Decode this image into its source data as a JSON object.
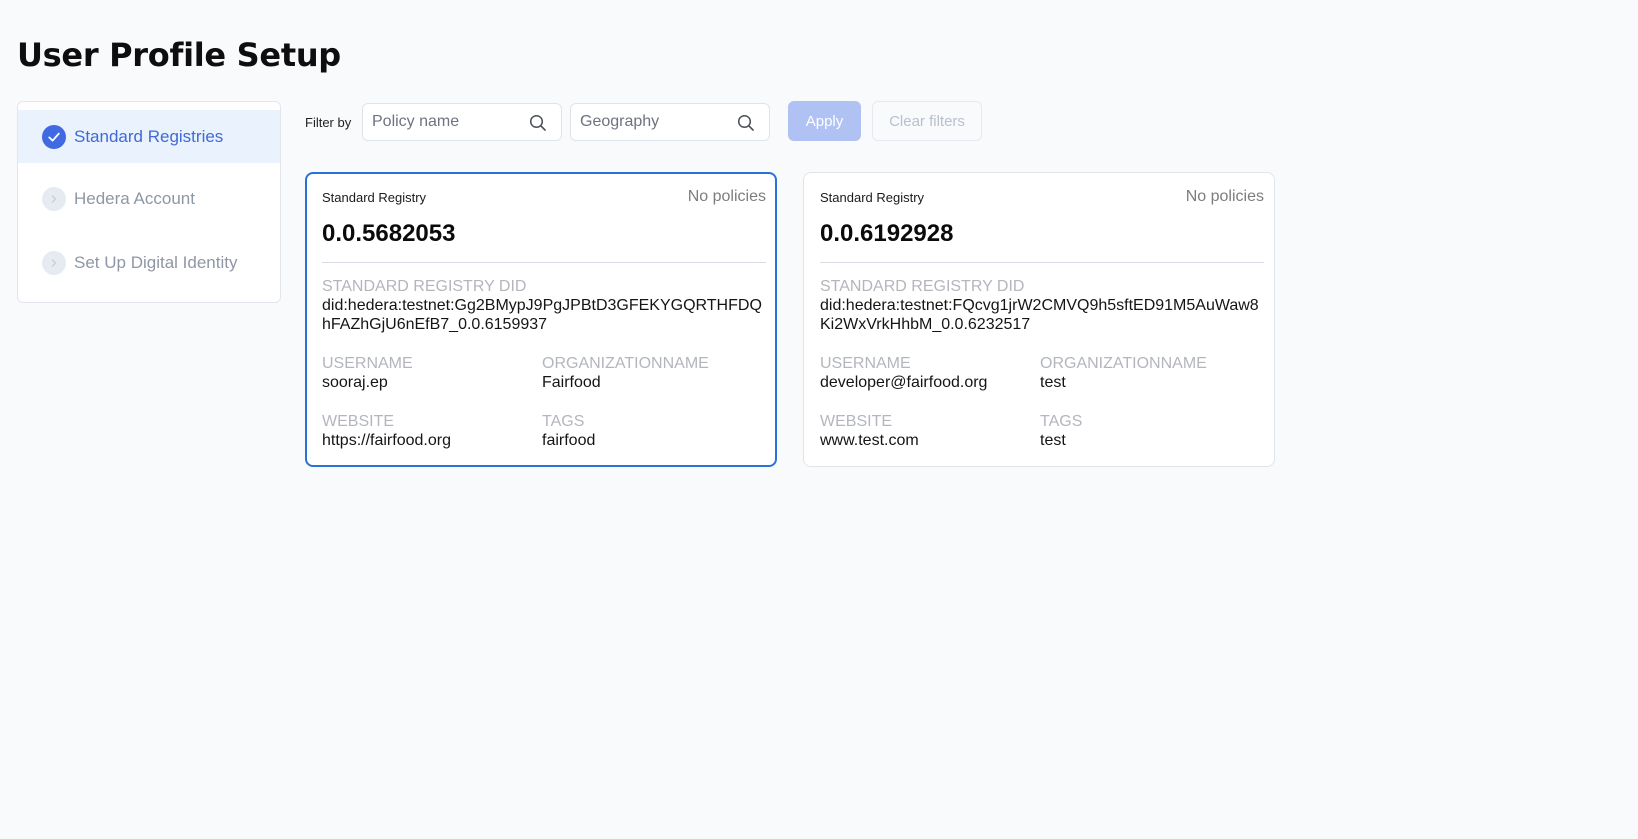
{
  "page": {
    "title": "User Profile Setup"
  },
  "sidebar": {
    "steps": [
      {
        "label": "Standard Registries",
        "state": "done",
        "icon": "check-icon"
      },
      {
        "label": "Hedera Account",
        "state": "pending",
        "icon": "chevron-right-icon"
      },
      {
        "label": "Set Up Digital Identity",
        "state": "pending",
        "icon": "chevron-right-icon"
      }
    ]
  },
  "filters": {
    "label": "Filter by",
    "policy_name_placeholder": "Policy name",
    "policy_name_value": "",
    "geography_placeholder": "Geography",
    "geography_value": "",
    "apply_label": "Apply",
    "clear_label": "Clear filters"
  },
  "field_labels": {
    "did": "Standard Registry DID",
    "username": "Username",
    "organization": "OrganizationName",
    "website": "Website",
    "tags": "Tags"
  },
  "cards": [
    {
      "type": "Standard Registry",
      "policies": "No policies",
      "id": "0.0.5682053",
      "did": "did:hedera:testnet:Gg2BMypJ9PgJPBtD3GFEKYGQRTHFDQhFAZhGjU6nEfB7_0.0.6159937",
      "username": "sooraj.ep",
      "organization": "Fairfood",
      "website": "https://fairfood.org",
      "tags": "fairfood",
      "selected": true
    },
    {
      "type": "Standard Registry",
      "policies": "No policies",
      "id": "0.0.6192928",
      "did": "did:hedera:testnet:FQcvg1jrW2CMVQ9h5sftED91M5AuWaw8Ki2WxVrkHhbM_0.0.6232517",
      "username": "developer@fairfood.org",
      "organization": "test",
      "website": "www.test.com",
      "tags": "test",
      "selected": false
    }
  ],
  "colors": {
    "accent": "#4169e1",
    "selected_border": "#2b72d6",
    "apply_disabled": "#b0c1f4",
    "active_step_bg": "#eaf3fd"
  }
}
